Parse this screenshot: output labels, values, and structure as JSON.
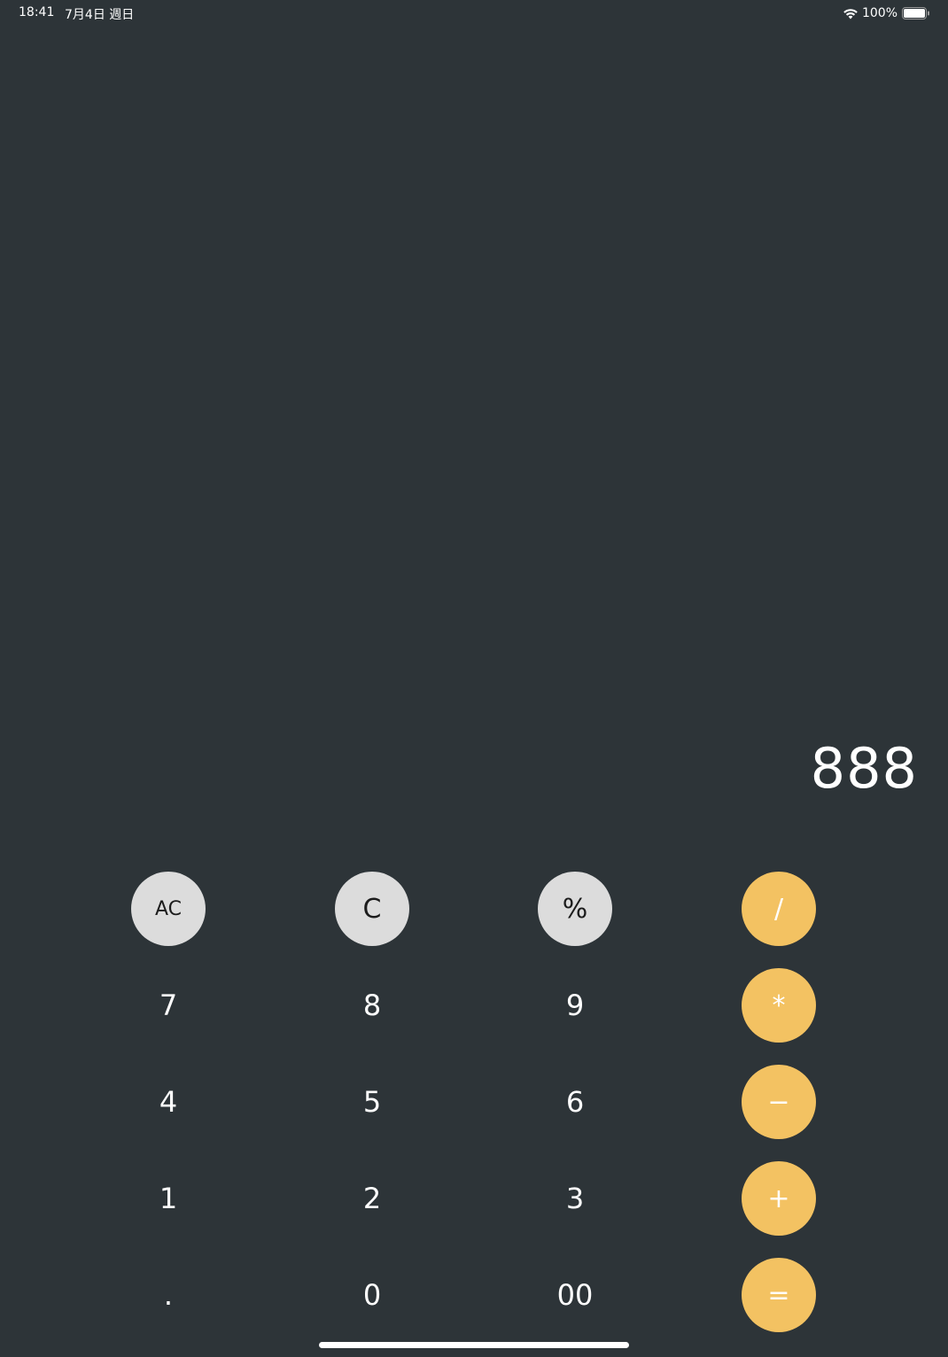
{
  "status_bar": {
    "time": "18:41",
    "date": "7月4日 週日",
    "battery_percent": "100%",
    "battery_level": 1.0
  },
  "display": {
    "value": "888"
  },
  "keys": {
    "ac": "AC",
    "c": "C",
    "percent": "%",
    "divide": "/",
    "seven": "7",
    "eight": "8",
    "nine": "9",
    "multiply": "*",
    "four": "4",
    "five": "5",
    "six": "6",
    "minus": "−",
    "one": "1",
    "two": "2",
    "three": "3",
    "plus": "+",
    "dot": ".",
    "zero": "0",
    "double_zero": "00",
    "equals": "="
  },
  "colors": {
    "background": "#2d3438",
    "light_key": "#dcdcdc",
    "operator_key": "#f3c262"
  }
}
